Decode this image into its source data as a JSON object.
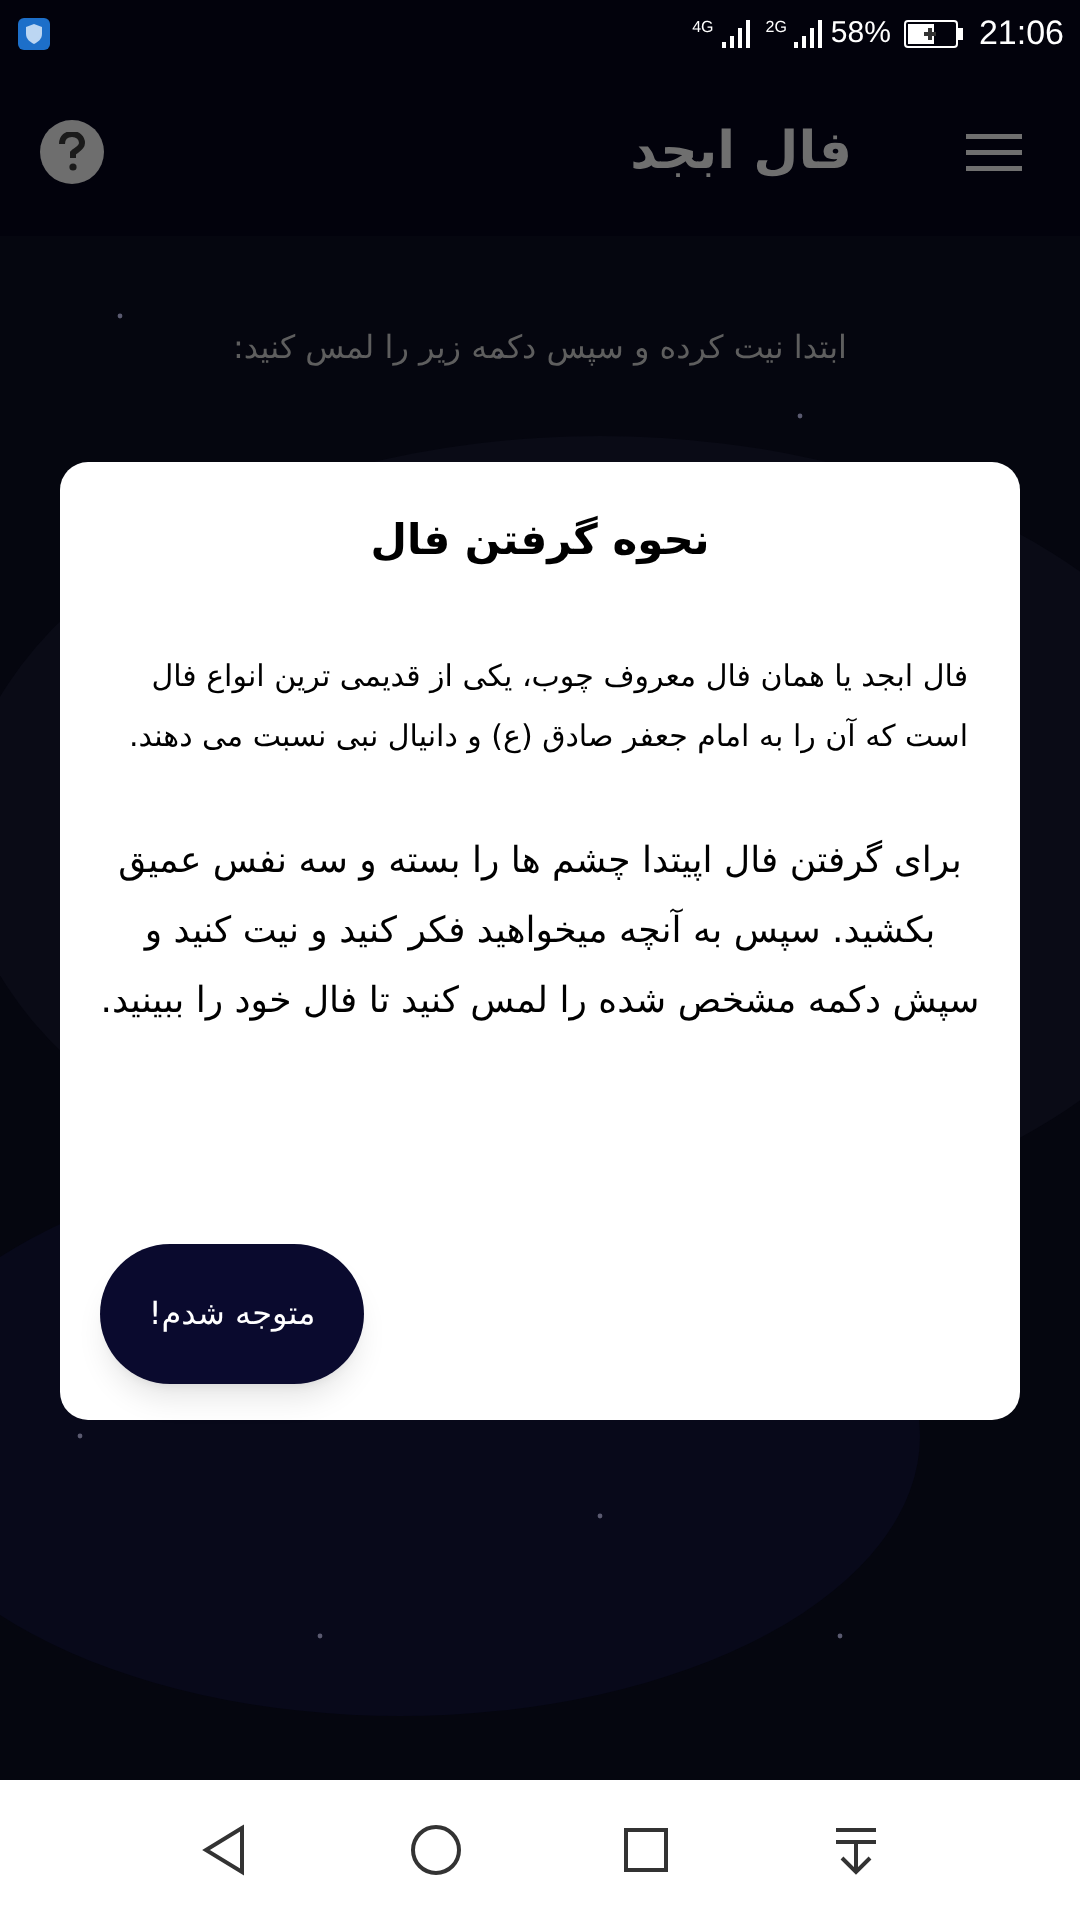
{
  "status_bar": {
    "network_1": "4G",
    "network_2": "2G",
    "battery": "58%",
    "time": "21:06"
  },
  "app_bar": {
    "title": "فال ابجد"
  },
  "instruction": "ابتدا نیت کرده و سپس دکمه زیر را لمس کنید:",
  "dialog": {
    "title": "نحوه گرفتن فال",
    "paragraphs": [
      {
        "text": "فال ابجد یا همان فال معروف چوب، یکی از قدیمی ترین انواع فال است که آن را به امام جعفر صادق (ع) و دانیال نبی نسبت می دهند.",
        "kind": "intro"
      },
      {
        "text": "برای گرفتن فال اپیتدا چشم ها را بسته و سه نفس عمیق بکشید. سپس به آنچه میخواهید فکر کنید و نیت کنید و سپش دکمه مشخص شده را لمس کنید تا فال خود را ببینید.",
        "kind": "steps"
      }
    ],
    "button": "متوجه شدم!"
  }
}
